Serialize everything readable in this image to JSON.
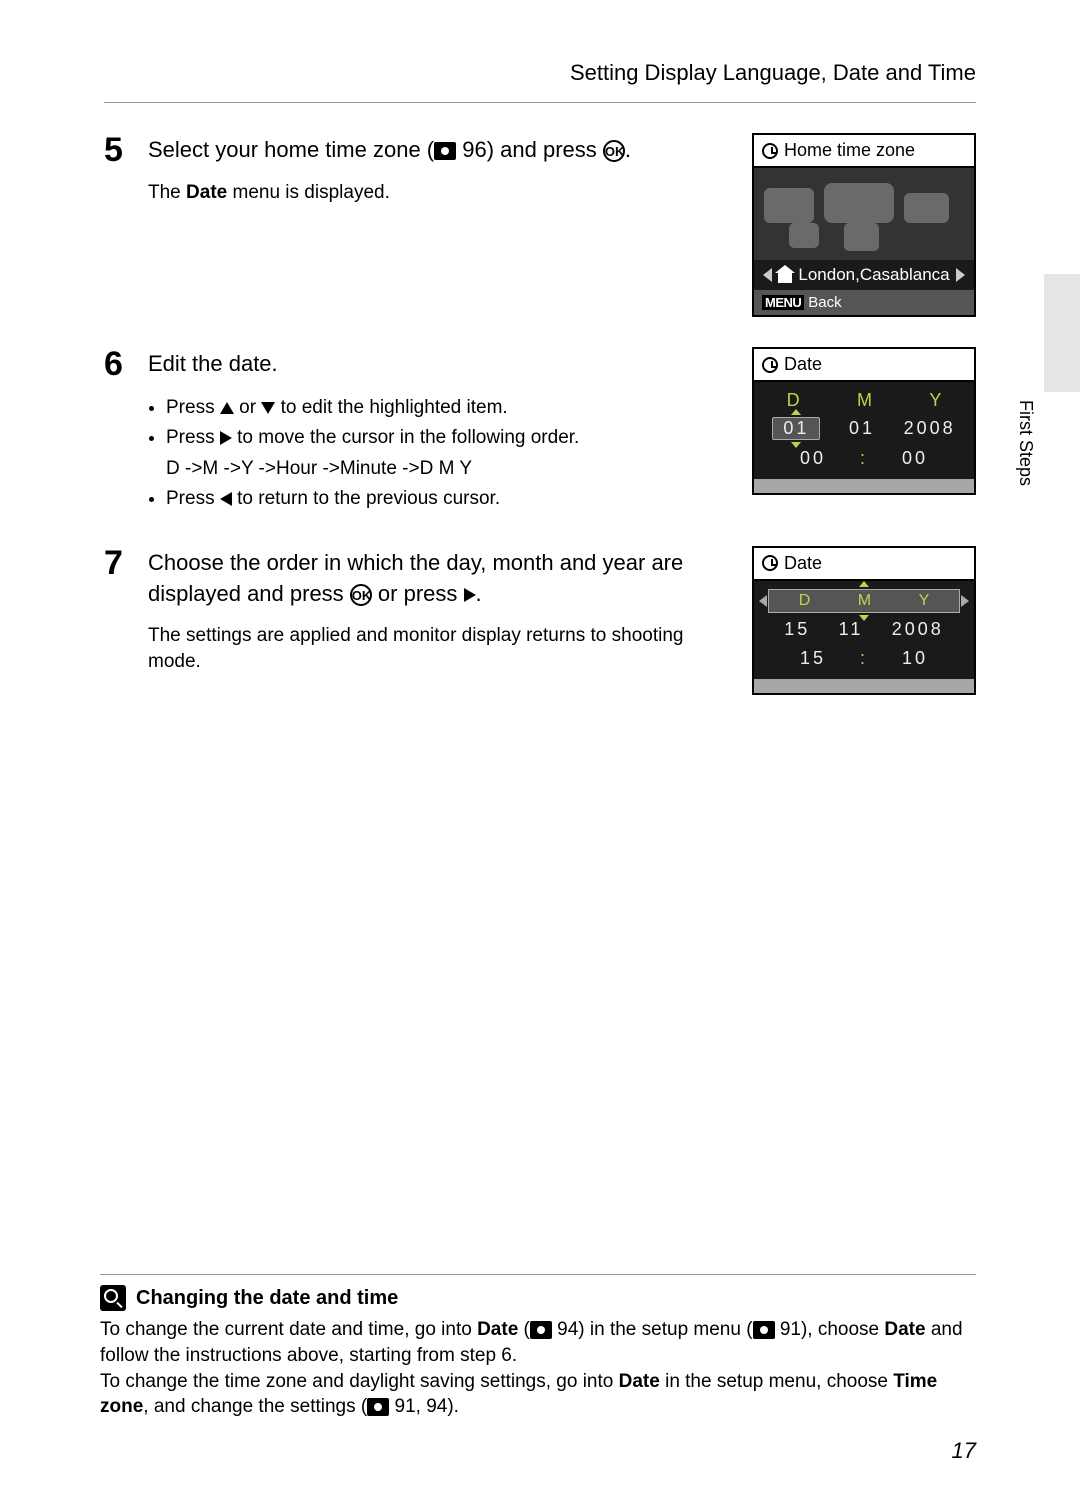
{
  "header": {
    "title": "Setting Display Language, Date and Time"
  },
  "side_label": "First Steps",
  "page_number": "17",
  "step5": {
    "num": "5",
    "title_a": "Select your home time zone (",
    "title_ref": " 96) and press ",
    "title_end": ".",
    "desc_a": "The ",
    "desc_bold": "Date",
    "desc_b": " menu is displayed.",
    "lcd": {
      "title": "Home time zone",
      "location": "London,Casablanca",
      "back": "Back"
    }
  },
  "step6": {
    "num": "6",
    "title": "Edit the date.",
    "b1_a": "Press ",
    "b1_b": " or ",
    "b1_c": " to edit the highlighted item.",
    "b2_a": "Press ",
    "b2_b": " to move the cursor in the following order.",
    "b2_sub": "D ->M ->Y ->Hour ->Minute ->D M Y",
    "b3_a": "Press ",
    "b3_b": " to return to the previous cursor.",
    "lcd": {
      "title": "Date",
      "d": "D",
      "m": "M",
      "y": "Y",
      "dv": "01",
      "mv": "01",
      "yv": "2008",
      "hh": "00",
      "mm": "00"
    }
  },
  "step7": {
    "num": "7",
    "title_a": "Choose the order in which the day, month and year are displayed and press ",
    "title_b": " or press ",
    "title_c": ".",
    "desc": "The settings are applied and monitor display returns to shooting mode.",
    "lcd": {
      "title": "Date",
      "d": "D",
      "m": "M",
      "y": "Y",
      "dv": "15",
      "mv": "11",
      "yv": "2008",
      "hh": "15",
      "mm": "10"
    }
  },
  "note": {
    "title": "Changing the date and time",
    "p1_a": "To change the current date and time, go into ",
    "p1_b": "Date",
    "p1_c": " (",
    "p1_ref1": " 94) in the setup menu (",
    "p1_ref2": " 91), choose ",
    "p1_d": "Date",
    "p1_e": " and follow the instructions above, starting from step 6.",
    "p2_a": "To change the time zone and daylight saving settings, go into ",
    "p2_b": "Date",
    "p2_c": " in the setup menu, choose ",
    "p2_d": "Time zone",
    "p2_e": ", and change the settings (",
    "p2_ref": " 91, 94)."
  }
}
